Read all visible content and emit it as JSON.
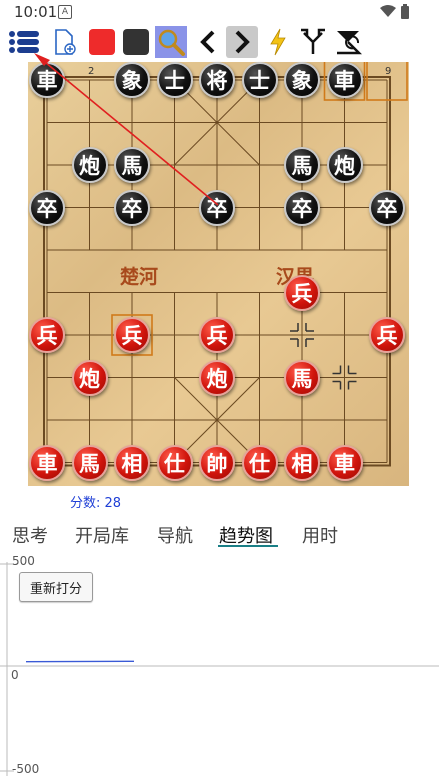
{
  "status_bar": {
    "time": "10:01",
    "notification_letter": "A"
  },
  "toolbar": {
    "items": [
      "menu-list-icon",
      "new-document-icon",
      "red-square-icon",
      "black-square-icon",
      "search-icon",
      "chevron-left-icon",
      "chevron-right-icon",
      "lightning-icon",
      "branch-icon",
      "flip-icon"
    ],
    "active": "chevron-right-icon"
  },
  "board": {
    "top_file_labels": [
      "2",
      "9"
    ],
    "river": {
      "left": "楚河",
      "right": "汉界"
    },
    "black_pieces": [
      {
        "char": "車",
        "file": 0,
        "rank": 0
      },
      {
        "char": "象",
        "file": 2,
        "rank": 0
      },
      {
        "char": "士",
        "file": 3,
        "rank": 0
      },
      {
        "char": "将",
        "file": 4,
        "rank": 0
      },
      {
        "char": "士",
        "file": 5,
        "rank": 0
      },
      {
        "char": "象",
        "file": 6,
        "rank": 0
      },
      {
        "char": "車",
        "file": 7,
        "rank": 0
      },
      {
        "char": "炮",
        "file": 1,
        "rank": 2
      },
      {
        "char": "馬",
        "file": 2,
        "rank": 2
      },
      {
        "char": "馬",
        "file": 6,
        "rank": 2
      },
      {
        "char": "炮",
        "file": 7,
        "rank": 2
      },
      {
        "char": "卒",
        "file": 0,
        "rank": 3
      },
      {
        "char": "卒",
        "file": 2,
        "rank": 3
      },
      {
        "char": "卒",
        "file": 4,
        "rank": 3
      },
      {
        "char": "卒",
        "file": 6,
        "rank": 3
      },
      {
        "char": "卒",
        "file": 8,
        "rank": 3
      }
    ],
    "red_pieces": [
      {
        "char": "兵",
        "file": 6,
        "rank": 5
      },
      {
        "char": "兵",
        "file": 0,
        "rank": 6
      },
      {
        "char": "兵",
        "file": 2,
        "rank": 6
      },
      {
        "char": "兵",
        "file": 4,
        "rank": 6
      },
      {
        "char": "兵",
        "file": 8,
        "rank": 6
      },
      {
        "char": "炮",
        "file": 1,
        "rank": 7
      },
      {
        "char": "炮",
        "file": 4,
        "rank": 7
      },
      {
        "char": "馬",
        "file": 6,
        "rank": 7
      },
      {
        "char": "車",
        "file": 0,
        "rank": 9
      },
      {
        "char": "馬",
        "file": 1,
        "rank": 9
      },
      {
        "char": "相",
        "file": 2,
        "rank": 9
      },
      {
        "char": "仕",
        "file": 3,
        "rank": 9
      },
      {
        "char": "帥",
        "file": 4,
        "rank": 9
      },
      {
        "char": "仕",
        "file": 5,
        "rank": 9
      },
      {
        "char": "相",
        "file": 6,
        "rank": 9
      },
      {
        "char": "車",
        "file": 7,
        "rank": 9
      }
    ],
    "highlight_squares": [
      {
        "file": 7,
        "rank": 0
      },
      {
        "file": 8,
        "rank": 0
      },
      {
        "file": 2,
        "rank": 6
      }
    ],
    "cross_marks": [
      {
        "file": 6,
        "rank": 6
      },
      {
        "file": 7,
        "rank": 7
      }
    ]
  },
  "score": {
    "label": "分数: 28"
  },
  "tabs": [
    {
      "label": "思考",
      "selected": false
    },
    {
      "label": "开局库",
      "selected": false
    },
    {
      "label": "导航",
      "selected": false
    },
    {
      "label": "趋势图",
      "selected": true
    },
    {
      "label": "用时",
      "selected": false
    }
  ],
  "trend": {
    "rescore_button": "重新打分",
    "y_top_label": "500",
    "y_zero_label": "0",
    "y_bottom_label": "-500",
    "ylim": [
      -500,
      500
    ],
    "series_values": [
      28,
      30
    ]
  },
  "colors": {
    "accent": "#1a7f86",
    "score_text": "#1f3fd6",
    "red_piece": "#d0140c",
    "black_piece": "#111111"
  }
}
